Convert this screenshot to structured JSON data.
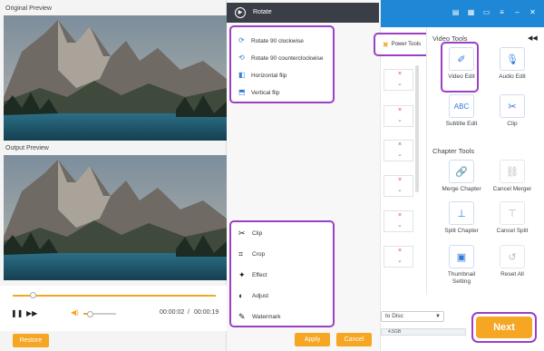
{
  "top_bar": {
    "icons": [
      "document-icon",
      "film-icon",
      "message-icon",
      "menu-icon",
      "minimize-icon",
      "close-icon"
    ]
  },
  "preview": {
    "original_label": "Original Preview",
    "output_label": "Output Preview",
    "progress_fraction": 0.1,
    "volume_fraction": 0.2,
    "current_time": "00:00:02",
    "separator": "/",
    "total_time": "00:00:19",
    "restore_label": "Restore"
  },
  "rotate_menu": {
    "title": "Rotate",
    "items": [
      {
        "label": "Rotate 90 clockwise",
        "icon": "rotate-cw-icon"
      },
      {
        "label": "Rotate 90 counterclockwise",
        "icon": "rotate-ccw-icon"
      },
      {
        "label": "Horizontal flip",
        "icon": "flip-horizontal-icon"
      },
      {
        "label": "Vertical flip",
        "icon": "flip-vertical-icon"
      }
    ],
    "tools": [
      {
        "label": "Clip",
        "icon": "scissors-icon"
      },
      {
        "label": "Crop",
        "icon": "crop-icon"
      },
      {
        "label": "Effect",
        "icon": "sparkle-icon"
      },
      {
        "label": "Adjust",
        "icon": "adjust-icon"
      },
      {
        "label": "Watermark",
        "icon": "brush-icon"
      }
    ],
    "apply_label": "Apply",
    "cancel_label": "Cancel"
  },
  "power_tools": {
    "label": "Power Tools"
  },
  "right_panel": {
    "video_tools_title": "Video Tools",
    "video_tools": [
      "Video Edit",
      "Audio Edit",
      "Subtitle Edit",
      "Clip"
    ],
    "subtitle_icon_text": "ABC",
    "chapter_tools_title": "Chapter Tools",
    "chapter_tools": [
      "Merge Chapter",
      "Cancel Merger",
      "Split Chapter",
      "Cancel Split",
      "Thumbnail Setting",
      "Reset All"
    ]
  },
  "bottom": {
    "disc_select": "to Disc",
    "capacity_label": "4.5GB",
    "next_label": "Next"
  },
  "colors": {
    "accent": "#f5a623",
    "header_blue": "#1e88d6",
    "highlight": "#9c3fc4"
  }
}
